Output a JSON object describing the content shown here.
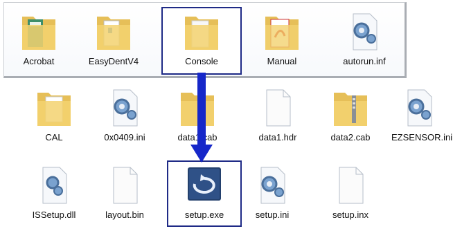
{
  "top_row": [
    {
      "label": "Acrobat",
      "icon": "folder-icon"
    },
    {
      "label": "EasyDentV4",
      "icon": "folder-icon"
    },
    {
      "label": "Console",
      "icon": "folder-icon"
    },
    {
      "label": "Manual",
      "icon": "folder-pdf-icon"
    },
    {
      "label": "autorun.inf",
      "icon": "settings-file-icon"
    }
  ],
  "row2": [
    {
      "label": "CAL",
      "icon": "folder-icon"
    },
    {
      "label": "0x0409.ini",
      "icon": "settings-file-icon"
    },
    {
      "label": "data1.cab",
      "icon": "folder-icon"
    },
    {
      "label": "data1.hdr",
      "icon": "blank-file-icon"
    },
    {
      "label": "data2.cab",
      "icon": "zip-folder-icon"
    },
    {
      "label": "EZSENSOR.ini",
      "icon": "settings-file-icon"
    }
  ],
  "row3": [
    {
      "label": "ISSetup.dll",
      "icon": "dll-file-icon"
    },
    {
      "label": "layout.bin",
      "icon": "blank-file-icon"
    },
    {
      "label": "setup.exe",
      "icon": "setup-exe-icon"
    },
    {
      "label": "setup.ini",
      "icon": "settings-file-icon"
    },
    {
      "label": "setup.inx",
      "icon": "blank-file-icon"
    }
  ],
  "colors": {
    "selection_border": "#1e2a86",
    "arrow": "#1627c9",
    "folder": "#f3d270"
  }
}
